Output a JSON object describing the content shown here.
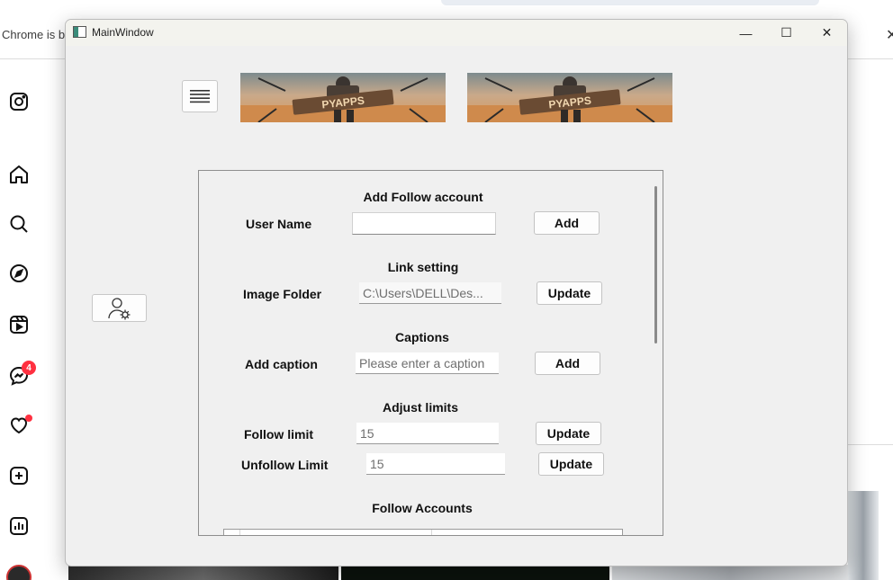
{
  "browser": {
    "infobar_text": "Chrome is b",
    "close_glyph": "✕",
    "sidebar_icons": [
      "instagram-icon",
      "home-icon",
      "search-icon",
      "explore-icon",
      "reels-icon",
      "messenger-icon",
      "heart-icon",
      "create-icon",
      "insights-icon"
    ],
    "messages_badge": "4"
  },
  "window": {
    "title": "MainWindow",
    "minimize_glyph": "—",
    "maximize_glyph": "☐",
    "close_glyph": "✕",
    "banner_text": "PYAPPS"
  },
  "form": {
    "follow_heading": "Add Follow account",
    "username_label": "User Name",
    "username_value": "",
    "add_follow_button": "Add",
    "link_heading": "Link setting",
    "image_folder_label": "Image Folder",
    "image_folder_value": "C:\\Users\\DELL\\Des...",
    "update_folder_button": "Update",
    "captions_heading": "Captions",
    "add_caption_label": "Add caption",
    "caption_placeholder": "Please enter a caption",
    "add_caption_button": "Add",
    "limits_heading": "Adjust limits",
    "follow_limit_label": "Follow limit",
    "follow_limit_value": "15",
    "update_follow_button": "Update",
    "unfollow_limit_label": "Unfollow Limit",
    "unfollow_limit_value": "15",
    "update_unfollow_button": "Update",
    "accounts_heading": "Follow Accounts"
  },
  "colors": {
    "window_bg": "#f0f0f0",
    "badge": "#ff3040"
  }
}
